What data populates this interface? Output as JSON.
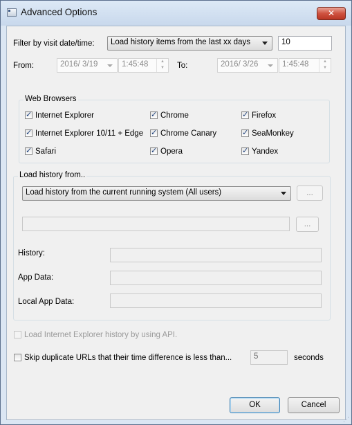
{
  "window": {
    "title": "Advanced Options",
    "close_glyph": "✕"
  },
  "filter": {
    "label": "Filter by visit date/time:",
    "mode_value": "Load history items from the last xx days",
    "days_value": "10"
  },
  "range": {
    "from_label": "From:",
    "from_date": "2016/  3/19",
    "from_time": "1:45:48",
    "to_label": "To:",
    "to_date": "2016/  3/26",
    "to_time": "1:45:48"
  },
  "browsers": {
    "title": "Web Browsers",
    "items": [
      {
        "label": "Internet Explorer",
        "checked": true
      },
      {
        "label": "Chrome",
        "checked": true
      },
      {
        "label": "Firefox",
        "checked": true
      },
      {
        "label": "Internet Explorer 10/11 + Edge",
        "checked": true
      },
      {
        "label": "Chrome Canary",
        "checked": true
      },
      {
        "label": "SeaMonkey",
        "checked": true
      },
      {
        "label": "Safari",
        "checked": true
      },
      {
        "label": "Opera",
        "checked": true
      },
      {
        "label": "Yandex",
        "checked": true
      }
    ]
  },
  "load_from": {
    "title": "Load history from..",
    "source_value": "Load history from the current running system (All users)",
    "browse_label": "...",
    "folder_value": "",
    "folder_browse_label": "...",
    "history_label": "History:",
    "history_value": "",
    "appdata_label": "App Data:",
    "appdata_value": "",
    "localappdata_label": "Local App Data:",
    "localappdata_value": ""
  },
  "options": {
    "ie_api_label": "Load Internet Explorer history by using API.",
    "ie_api_checked": false,
    "skip_dup_label": "Skip duplicate URLs that their time difference is less than...",
    "skip_dup_checked": false,
    "seconds_value": "5",
    "seconds_label": "seconds"
  },
  "buttons": {
    "ok": "OK",
    "cancel": "Cancel"
  }
}
